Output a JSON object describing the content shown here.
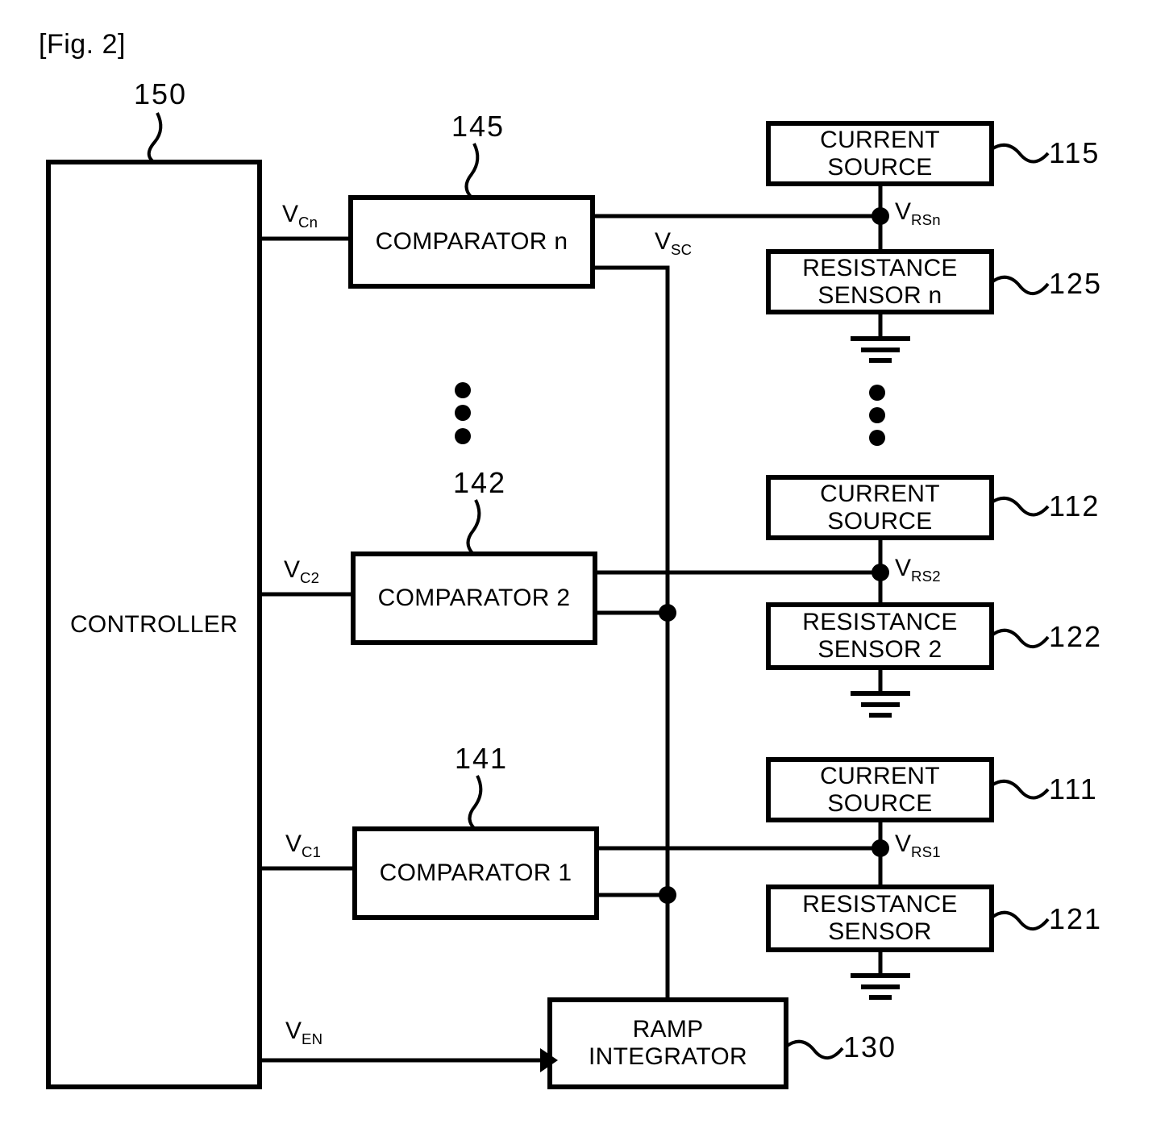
{
  "figure": {
    "caption": "[Fig. 2]"
  },
  "blocks": {
    "controller": {
      "label": "CONTROLLER",
      "ref": "150"
    },
    "comparator_n": {
      "label": "COMPARATOR n",
      "ref": "145"
    },
    "comparator_2": {
      "label": "COMPARATOR 2",
      "ref": "142"
    },
    "comparator_1": {
      "label": "COMPARATOR 1",
      "ref": "141"
    },
    "ramp_integrator": {
      "label": "RAMP\nINTEGRATOR",
      "ref": "130"
    },
    "current_source_n": {
      "label": "CURRENT SOURCE",
      "ref": "115"
    },
    "current_source_2": {
      "label": "CURRENT SOURCE",
      "ref": "112"
    },
    "current_source_1": {
      "label": "CURRENT SOURCE",
      "ref": "111"
    },
    "resistance_sensor_n": {
      "label": "RESISTANCE\nSENSOR n",
      "ref": "125"
    },
    "resistance_sensor_2": {
      "label": "RESISTANCE\nSENSOR 2",
      "ref": "122"
    },
    "resistance_sensor_1": {
      "label": "RESISTANCE\nSENSOR",
      "ref": "121"
    }
  },
  "signals": {
    "vcn": {
      "base": "V",
      "sub": "Cn"
    },
    "vc2": {
      "base": "V",
      "sub": "C2"
    },
    "vc1": {
      "base": "V",
      "sub": "C1"
    },
    "ven": {
      "base": "V",
      "sub": "EN"
    },
    "vsc": {
      "base": "V",
      "sub": "SC"
    },
    "vrsn": {
      "base": "V",
      "sub": "RSn"
    },
    "vrs2": {
      "base": "V",
      "sub": "RS2"
    },
    "vrs1": {
      "base": "V",
      "sub": "RS1"
    }
  },
  "symbols": {
    "ellipsis_comparators": "vertical-ellipsis",
    "ellipsis_sensors": "vertical-ellipsis",
    "ground_n": "ground-symbol",
    "ground_2": "ground-symbol",
    "ground_1": "ground-symbol"
  },
  "colors": {
    "line": "#000000",
    "background": "#ffffff"
  }
}
